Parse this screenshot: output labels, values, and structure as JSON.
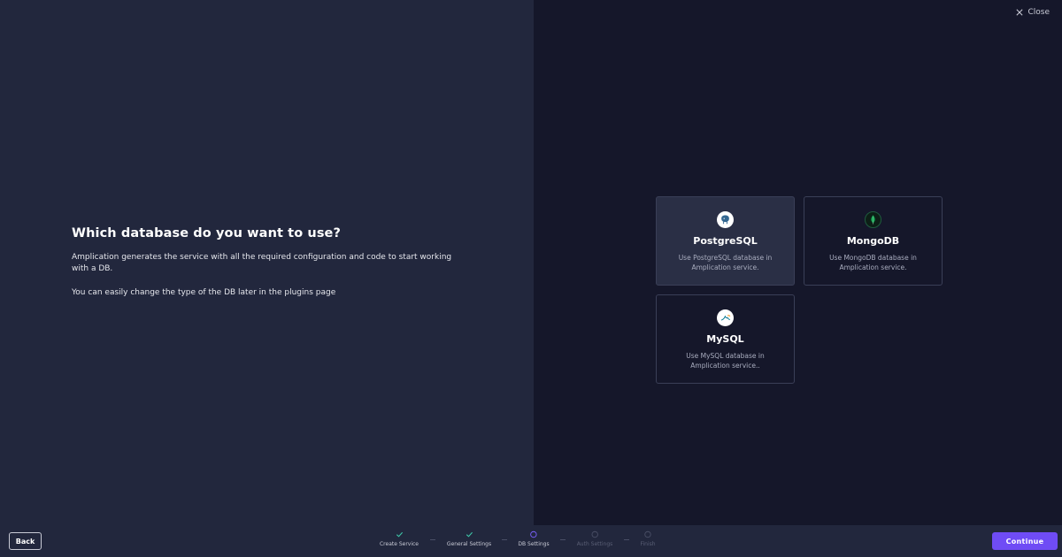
{
  "left": {
    "heading": "Which database do you want to use?",
    "description": "Amplication generates the service with all the required configuration and code to start working with a DB.",
    "hint": "You can easily change the type of the DB later in the plugins page"
  },
  "close_label": "Close",
  "databases": [
    {
      "name": "PostgreSQL",
      "description": "Use PostgreSQL database in Amplication service.",
      "icon": "postgresql-icon",
      "selected": true
    },
    {
      "name": "MongoDB",
      "description": "Use MongoDB database in Amplication service.",
      "icon": "mongodb-icon",
      "selected": false
    },
    {
      "name": "MySQL",
      "description": "Use MySQL database in Amplication service..",
      "icon": "mysql-icon",
      "selected": false
    }
  ],
  "footer": {
    "back_label": "Back",
    "continue_label": "Continue",
    "steps": [
      {
        "label": "Create Service",
        "status": "done"
      },
      {
        "label": "General Settings",
        "status": "done"
      },
      {
        "label": "DB Settings",
        "status": "current"
      },
      {
        "label": "Auth Settings",
        "status": "todo"
      },
      {
        "label": "Finish",
        "status": "todo"
      }
    ]
  },
  "colors": {
    "accent": "#6f4cf5",
    "done": "#3ec6a8",
    "panel": "#22273d",
    "background": "#15172a"
  }
}
